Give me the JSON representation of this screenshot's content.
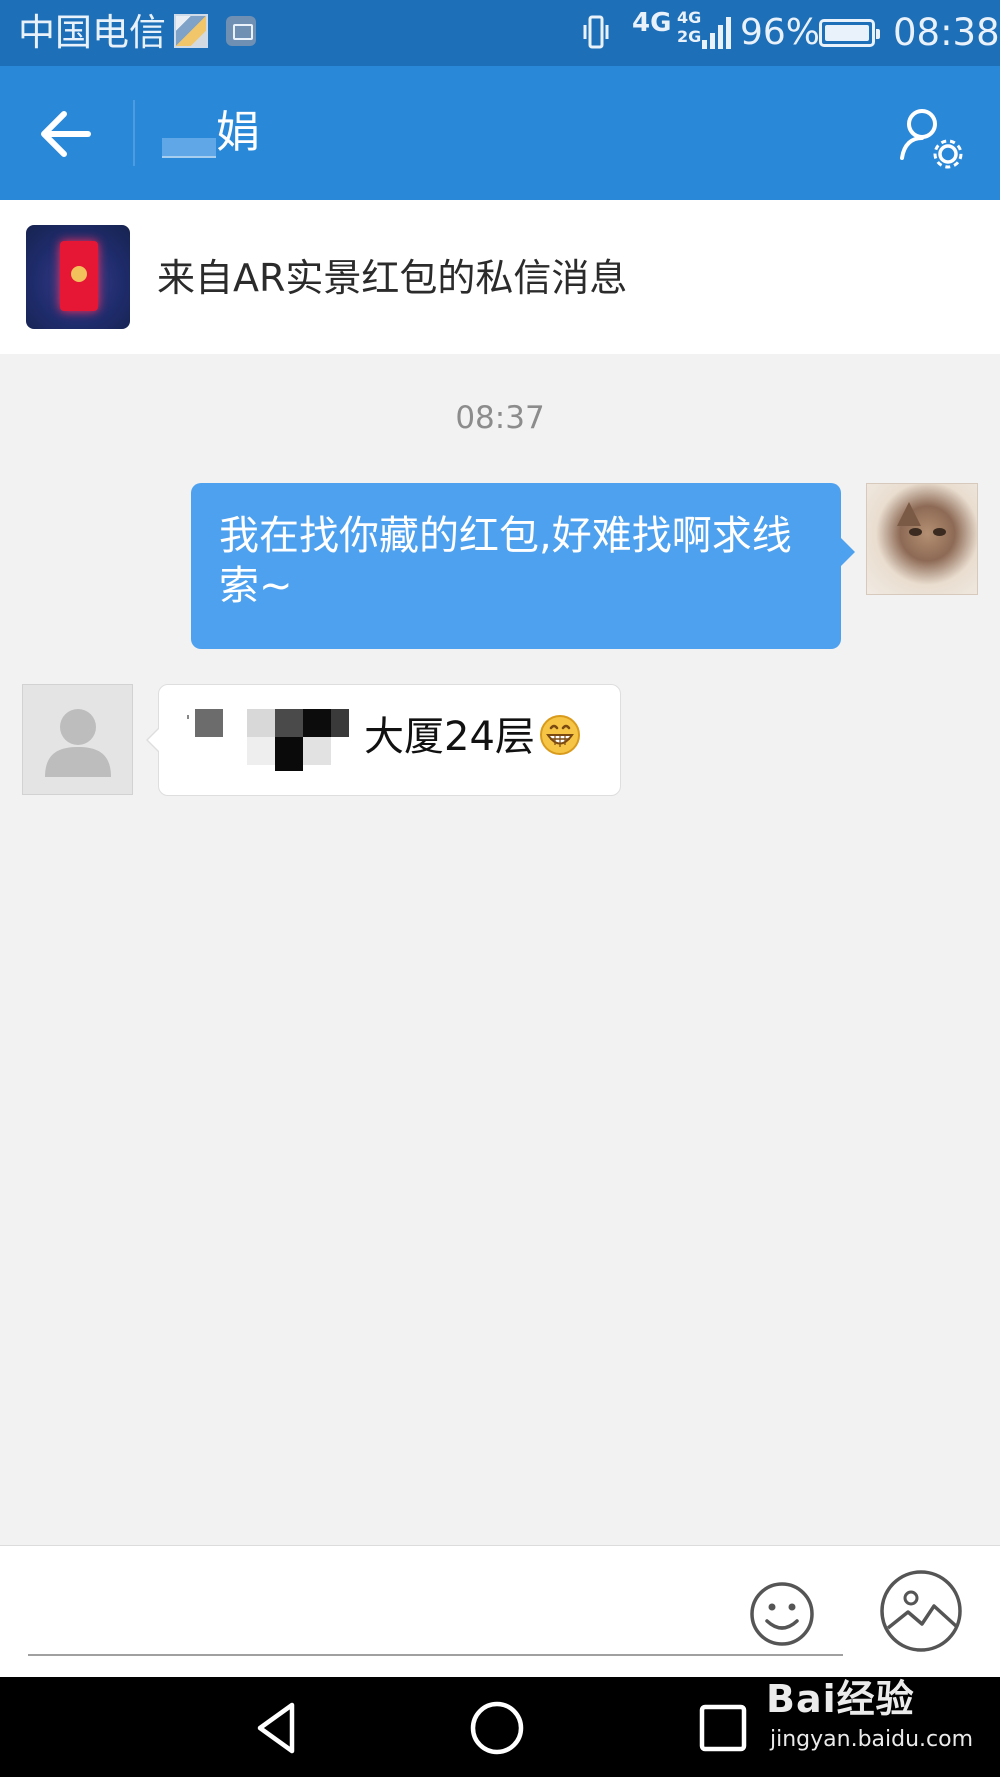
{
  "status_bar": {
    "carrier": "中国电信",
    "network": "4G",
    "network2_top": "4G",
    "network2_bottom": "2G",
    "battery_percent": "96%",
    "battery_level": 0.96,
    "time": "08:38"
  },
  "header": {
    "contact_name": "娟"
  },
  "notice": {
    "text": "来自AR实景红包的私信消息"
  },
  "chat": {
    "timestamp": "08:37",
    "messages": [
      {
        "direction": "outgoing",
        "text": "我在找你藏的红包,好难找啊求线索~"
      },
      {
        "direction": "incoming",
        "text": "大厦24层"
      }
    ]
  },
  "input": {
    "value": "",
    "placeholder": ""
  },
  "watermark": {
    "main": "Bai经验",
    "sub": "jingyan.baidu.com"
  },
  "colors": {
    "status_bar": "#1d6fb7",
    "title_bar": "#2a88d8",
    "outgoing_bubble": "#4ea1ef",
    "background": "#f2f2f2"
  }
}
